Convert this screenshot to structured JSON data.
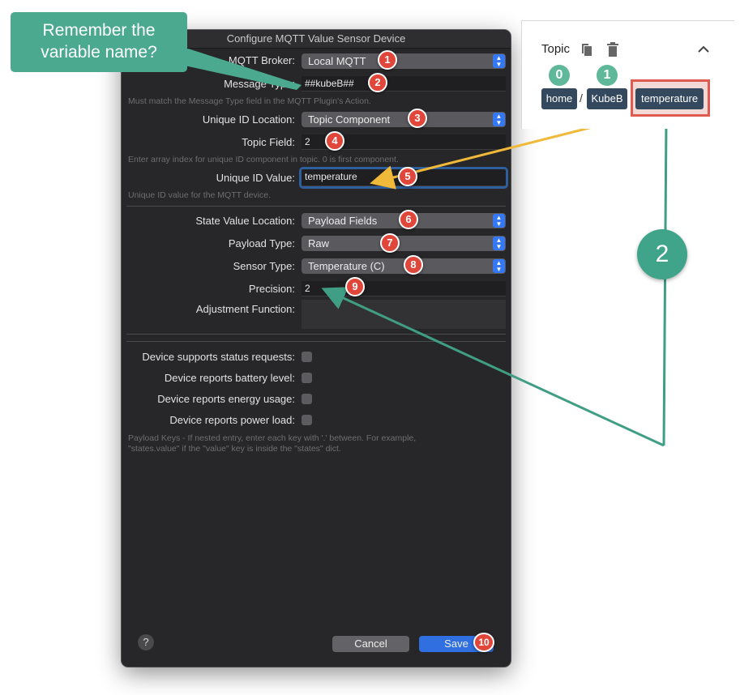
{
  "dialog": {
    "title": "Configure MQTT Value Sensor Device",
    "broker_label": "MQTT Broker:",
    "broker_value": "Local MQTT",
    "message_type_label": "Message Type:",
    "message_type_value": "##kubeB##",
    "message_type_hint": "Must match the Message Type field in the MQTT Plugin's Action.",
    "uid_location_label": "Unique ID Location:",
    "uid_location_value": "Topic Component",
    "topic_field_label": "Topic Field:",
    "topic_field_value": "2",
    "topic_field_hint": "Enter array index for unique ID component in topic.  0 is first component.",
    "uid_value_label": "Unique ID Value:",
    "uid_value_value": "temperature",
    "uid_value_hint": "Unique ID value for the MQTT device.",
    "state_location_label": "State Value Location:",
    "state_location_value": "Payload Fields",
    "payload_type_label": "Payload Type:",
    "payload_type_value": "Raw",
    "sensor_type_label": "Sensor Type:",
    "sensor_type_value": "Temperature (C)",
    "precision_label": "Precision:",
    "precision_value": "2",
    "adjustment_label": "Adjustment Function:",
    "checks": [
      "Device supports status requests:",
      "Device reports battery level:",
      "Device reports energy usage:",
      "Device reports power load:"
    ],
    "payload_hint_1": "Payload Keys - If nested entry, enter each key with '.' between.  For example,",
    "payload_hint_2": "\"states.value\" if the \"value\" key is inside the \"states\" dict.",
    "help": "?",
    "cancel_label": "Cancel",
    "save_label": "Save"
  },
  "badges": [
    "1",
    "2",
    "3",
    "4",
    "5",
    "6",
    "7",
    "8",
    "9",
    "10"
  ],
  "callout": {
    "line1": "Remember the",
    "line2": "variable name?"
  },
  "topic_panel": {
    "title": "Topic",
    "copy_icon": "copy-icon",
    "delete_icon": "trash-icon",
    "collapse_icon": "chevron-up-icon",
    "separator": "/",
    "parts": [
      {
        "index": "0",
        "label": "home"
      },
      {
        "index": "1",
        "label": "KubeB"
      },
      {
        "label": "temperature"
      }
    ]
  },
  "big_badge": "2",
  "colors": {
    "callout": "#4aa98e",
    "badge": "#e0463a",
    "accent": "#3478f6",
    "highlight": "#e05b4f",
    "arrow_yellow": "#f0b93a"
  }
}
